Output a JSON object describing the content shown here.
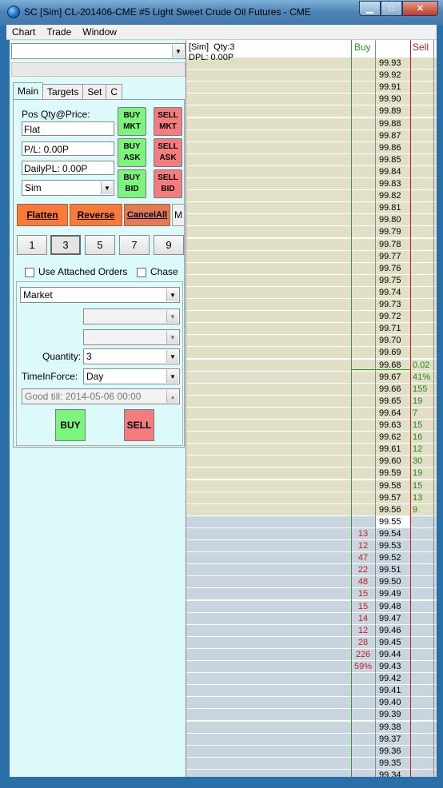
{
  "window": {
    "title": "SC [Sim] CL-201406-CME  #5  Light Sweet Crude Oil Futures - CME",
    "min_label": "▁",
    "max_label": "□",
    "close_label": "✕"
  },
  "menu": [
    "Chart",
    "Trade",
    "Window"
  ],
  "tabs": [
    "Main",
    "Targets",
    "Set",
    "C"
  ],
  "panel": {
    "pos_label": "Pos Qty@Price:",
    "pos_value": "Flat",
    "pl_value": "P/L: 0.00P",
    "daily_pl_value": "DailyPL: 0.00P",
    "account": "Sim",
    "buy_mkt": "BUY MKT",
    "sell_mkt": "SELL MKT",
    "buy_ask": "BUY ASK",
    "sell_ask": "SELL ASK",
    "buy_bid": "BUY BID",
    "sell_bid": "SELL BID",
    "flatten": "Flatten",
    "reverse": "Reverse",
    "cancel_all": "CancelAll",
    "m": "M",
    "qty_buttons": [
      "1",
      "3",
      "5",
      "7",
      "9"
    ],
    "active_qty": "3",
    "use_attached": "Use Attached Orders",
    "chase": "Chase",
    "order_type": "Market",
    "quantity_label": "Quantity:",
    "quantity_value": "3",
    "tif_label": "TimeInForce:",
    "tif_value": "Day",
    "good_till": "Good till: 2014-05-06 00:00",
    "buy": "BUY",
    "sell": "SELL"
  },
  "dom": {
    "info_line1": "[Sim]  Qty:3",
    "info_line2": "DPL: 0.00P",
    "buy_header": "Buy",
    "sell_header": "Sell",
    "colors": {
      "ask_bg": "#e1dfc5",
      "bid_bg": "#c9d5de",
      "buy_text": "#c41e1e",
      "sell_text": "#1f8a1f"
    },
    "last_trade": "99.55",
    "rows": [
      {
        "price": "99.93",
        "side": "ask",
        "buy": "",
        "sell": ""
      },
      {
        "price": "99.92",
        "side": "ask",
        "buy": "",
        "sell": ""
      },
      {
        "price": "99.91",
        "side": "ask",
        "buy": "",
        "sell": ""
      },
      {
        "price": "99.90",
        "side": "ask",
        "buy": "",
        "sell": ""
      },
      {
        "price": "99.89",
        "side": "ask",
        "buy": "",
        "sell": ""
      },
      {
        "price": "99.88",
        "side": "ask",
        "buy": "",
        "sell": ""
      },
      {
        "price": "99.87",
        "side": "ask",
        "buy": "",
        "sell": ""
      },
      {
        "price": "99.86",
        "side": "ask",
        "buy": "",
        "sell": ""
      },
      {
        "price": "99.85",
        "side": "ask",
        "buy": "",
        "sell": ""
      },
      {
        "price": "99.84",
        "side": "ask",
        "buy": "",
        "sell": ""
      },
      {
        "price": "99.83",
        "side": "ask",
        "buy": "",
        "sell": ""
      },
      {
        "price": "99.82",
        "side": "ask",
        "buy": "",
        "sell": ""
      },
      {
        "price": "99.81",
        "side": "ask",
        "buy": "",
        "sell": ""
      },
      {
        "price": "99.80",
        "side": "ask",
        "buy": "",
        "sell": ""
      },
      {
        "price": "99.79",
        "side": "ask",
        "buy": "",
        "sell": ""
      },
      {
        "price": "99.78",
        "side": "ask",
        "buy": "",
        "sell": ""
      },
      {
        "price": "99.77",
        "side": "ask",
        "buy": "",
        "sell": ""
      },
      {
        "price": "99.76",
        "side": "ask",
        "buy": "",
        "sell": ""
      },
      {
        "price": "99.75",
        "side": "ask",
        "buy": "",
        "sell": ""
      },
      {
        "price": "99.74",
        "side": "ask",
        "buy": "",
        "sell": ""
      },
      {
        "price": "99.73",
        "side": "ask",
        "buy": "",
        "sell": ""
      },
      {
        "price": "99.72",
        "side": "ask",
        "buy": "",
        "sell": ""
      },
      {
        "price": "99.71",
        "side": "ask",
        "buy": "",
        "sell": ""
      },
      {
        "price": "99.70",
        "side": "ask",
        "buy": "",
        "sell": ""
      },
      {
        "price": "99.69",
        "side": "ask",
        "buy": "",
        "sell": ""
      },
      {
        "price": "99.68",
        "side": "ask",
        "buy": "",
        "sell": "0.02"
      },
      {
        "price": "99.67",
        "side": "ask",
        "buy": "",
        "sell": "41%"
      },
      {
        "price": "99.66",
        "side": "ask",
        "buy": "",
        "sell": "155"
      },
      {
        "price": "99.65",
        "side": "ask",
        "buy": "",
        "sell": "19"
      },
      {
        "price": "99.64",
        "side": "ask",
        "buy": "",
        "sell": "7"
      },
      {
        "price": "99.63",
        "side": "ask",
        "buy": "",
        "sell": "15"
      },
      {
        "price": "99.62",
        "side": "ask",
        "buy": "",
        "sell": "16"
      },
      {
        "price": "99.61",
        "side": "ask",
        "buy": "",
        "sell": "12"
      },
      {
        "price": "99.60",
        "side": "ask",
        "buy": "",
        "sell": "30"
      },
      {
        "price": "99.59",
        "side": "ask",
        "buy": "",
        "sell": "19"
      },
      {
        "price": "99.58",
        "side": "ask",
        "buy": "",
        "sell": "15"
      },
      {
        "price": "99.57",
        "side": "ask",
        "buy": "",
        "sell": "13"
      },
      {
        "price": "99.56",
        "side": "ask",
        "buy": "",
        "sell": "9"
      },
      {
        "price": "99.55",
        "side": "cur",
        "buy": "",
        "sell": ""
      },
      {
        "price": "99.54",
        "side": "bid",
        "buy": "13",
        "sell": ""
      },
      {
        "price": "99.53",
        "side": "bid",
        "buy": "12",
        "sell": ""
      },
      {
        "price": "99.52",
        "side": "bid",
        "buy": "47",
        "sell": ""
      },
      {
        "price": "99.51",
        "side": "bid",
        "buy": "22",
        "sell": ""
      },
      {
        "price": "99.50",
        "side": "bid",
        "buy": "48",
        "sell": ""
      },
      {
        "price": "99.49",
        "side": "bid",
        "buy": "15",
        "sell": ""
      },
      {
        "price": "99.48",
        "side": "bid",
        "buy": "15",
        "sell": ""
      },
      {
        "price": "99.47",
        "side": "bid",
        "buy": "14",
        "sell": ""
      },
      {
        "price": "99.46",
        "side": "bid",
        "buy": "12",
        "sell": ""
      },
      {
        "price": "99.45",
        "side": "bid",
        "buy": "28",
        "sell": ""
      },
      {
        "price": "99.44",
        "side": "bid",
        "buy": "226",
        "sell": ""
      },
      {
        "price": "99.43",
        "side": "bid",
        "buy": "59%",
        "sell": ""
      },
      {
        "price": "99.42",
        "side": "bid",
        "buy": "",
        "sell": ""
      },
      {
        "price": "99.41",
        "side": "bid",
        "buy": "",
        "sell": ""
      },
      {
        "price": "99.40",
        "side": "bid",
        "buy": "",
        "sell": ""
      },
      {
        "price": "99.39",
        "side": "bid",
        "buy": "",
        "sell": ""
      },
      {
        "price": "99.38",
        "side": "bid",
        "buy": "",
        "sell": ""
      },
      {
        "price": "99.37",
        "side": "bid",
        "buy": "",
        "sell": ""
      },
      {
        "price": "99.36",
        "side": "bid",
        "buy": "",
        "sell": ""
      },
      {
        "price": "99.35",
        "side": "bid",
        "buy": "",
        "sell": ""
      },
      {
        "price": "99.34",
        "side": "bid",
        "buy": "",
        "sell": ""
      }
    ]
  }
}
